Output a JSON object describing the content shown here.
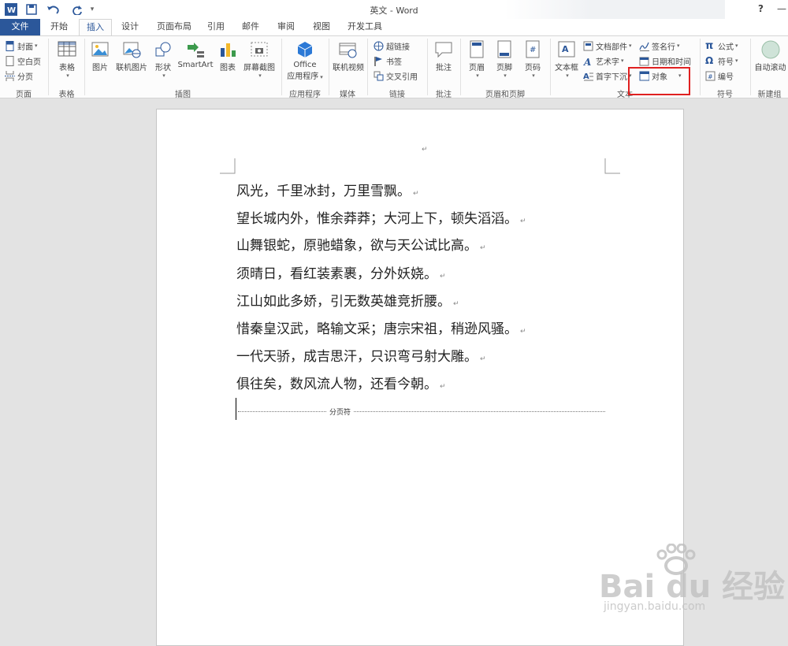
{
  "window": {
    "title": "英文 - Word",
    "help": "?"
  },
  "tabs": [
    {
      "label": "文件"
    },
    {
      "label": "开始"
    },
    {
      "label": "插入"
    },
    {
      "label": "设计"
    },
    {
      "label": "页面布局"
    },
    {
      "label": "引用"
    },
    {
      "label": "邮件"
    },
    {
      "label": "审阅"
    },
    {
      "label": "视图"
    },
    {
      "label": "开发工具"
    }
  ],
  "ribbon": {
    "pages": {
      "label": "页面",
      "cover": "封面",
      "blank": "空白页",
      "break": "分页"
    },
    "tables": {
      "label": "表格",
      "table": "表格"
    },
    "illustrations": {
      "label": "插图",
      "picture": "图片",
      "online_picture": "联机图片",
      "shapes": "形状",
      "smartart": "SmartArt",
      "chart": "图表",
      "screenshot": "屏幕截图"
    },
    "apps": {
      "label": "应用程序",
      "office_line1": "Office",
      "office_line2": "应用程序"
    },
    "media": {
      "label": "媒体",
      "online_video": "联机视频"
    },
    "links": {
      "label": "链接",
      "hyperlink": "超链接",
      "bookmark": "书签",
      "cross_ref": "交叉引用"
    },
    "comments": {
      "label": "批注",
      "comment": "批注"
    },
    "header_footer": {
      "label": "页眉和页脚",
      "header": "页眉",
      "footer": "页脚",
      "page_number": "页码"
    },
    "text": {
      "label": "文本",
      "textbox": "文本框",
      "quick_parts": "文档部件",
      "wordart": "艺术字",
      "dropcap": "首字下沉",
      "signature": "签名行",
      "datetime": "日期和时间",
      "object": "对象"
    },
    "symbols": {
      "label": "符号",
      "equation": "公式",
      "symbol": "符号",
      "number": "编号"
    },
    "new_group": {
      "label": "新建组",
      "autoscroll": "自动滚动"
    }
  },
  "document": {
    "lines": [
      "风光，千里冰封，万里雪飘。",
      "望长城内外，惟余莽莽；大河上下，顿失滔滔。",
      "山舞银蛇，原驰蜡象，欲与天公试比高。",
      "须晴日，看红装素裹，分外妖娆。",
      "江山如此多娇，引无数英雄竞折腰。",
      "惜秦皇汉武，略输文采；唐宗宋祖，稍逊风骚。",
      "一代天骄，成吉思汗，只识弯弓射大雕。",
      "俱往矣，数风流人物，还看今朝。"
    ],
    "para_mark": "↵",
    "page_break_label": "分页符"
  },
  "watermark": {
    "brand": "Bai du 经验",
    "url": "jingyan.baidu.com"
  },
  "colors": {
    "accent": "#2b579a",
    "highlight": "#e02020",
    "word_blue": "#2b579a"
  }
}
